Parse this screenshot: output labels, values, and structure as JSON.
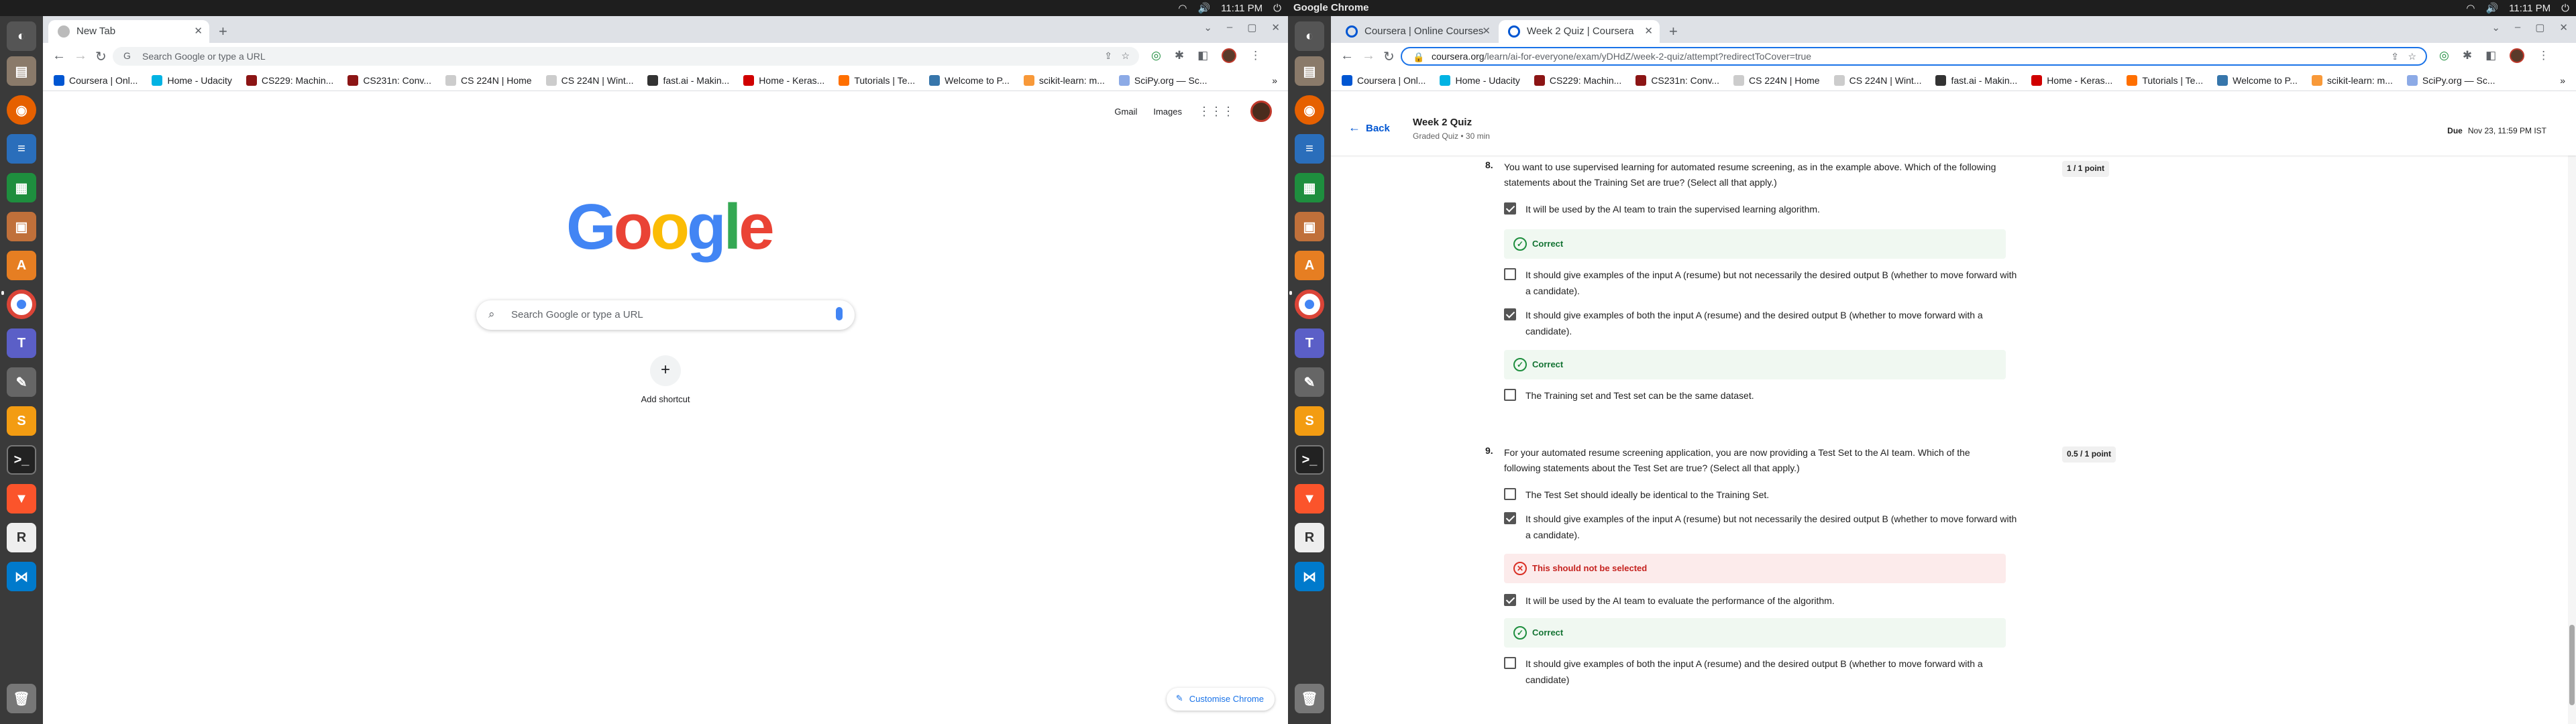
{
  "left": {
    "topbar": {
      "time": "11:11 PM",
      "app": ""
    },
    "tabs": [
      {
        "title": "New Tab"
      }
    ],
    "omnibox": {
      "placeholder": "Search Google or type a URL"
    },
    "bookmarks": [
      "Coursera | Onl...",
      "Home - Udacity",
      "CS229: Machin...",
      "CS231n: Conv...",
      "CS 224N | Home",
      "CS 224N | Wint...",
      "fast.ai - Makin...",
      "Home - Keras...",
      "Tutorials | Te...",
      "Welcome to P...",
      "scikit-learn: m...",
      "SciPy.org — Sc..."
    ],
    "google": {
      "gmail": "Gmail",
      "images": "Images",
      "search_placeholder": "Search Google or type a URL",
      "add_shortcut": "Add shortcut",
      "customise": "Customise Chrome"
    }
  },
  "right": {
    "topbar": {
      "time": "11:11 PM",
      "app": "Google Chrome"
    },
    "tabs": [
      {
        "title": "Coursera | Online Courses"
      },
      {
        "title": "Week 2 Quiz | Coursera"
      }
    ],
    "omnibox": {
      "url_host": "coursera.org",
      "url_path": "/learn/ai-for-everyone/exam/yDHdZ/week-2-quiz/attempt?redirectToCover=true"
    },
    "bookmarks": [
      "Coursera | Onl...",
      "Home - Udacity",
      "CS229: Machin...",
      "CS231n: Conv...",
      "CS 224N | Home",
      "CS 224N | Wint...",
      "fast.ai - Makin...",
      "Home - Keras...",
      "Tutorials | Te...",
      "Welcome to P...",
      "scikit-learn: m...",
      "SciPy.org — Sc..."
    ],
    "quiz": {
      "back": "Back",
      "title": "Week 2 Quiz",
      "subtitle": "Graded Quiz • 30 min",
      "due_label": "Due",
      "due_date": "Nov 23, 11:59 PM IST",
      "questions": [
        {
          "number": "8.",
          "text": "You want to use supervised learning for automated resume screening, as in the example above. Which of the following statements about the Training Set are true? (Select all that apply.)",
          "score": "1 / 1 point",
          "options": [
            {
              "text": "It will be used by the AI team to train the supervised learning algorithm.",
              "checked": true,
              "feedback": "Correct"
            },
            {
              "text": "It should give examples of the input A (resume) but not necessarily the desired output B (whether to move forward with a candidate).",
              "checked": false,
              "feedback": ""
            },
            {
              "text": "It should give examples of both the input A (resume) and the desired output B (whether to move forward with a candidate).",
              "checked": true,
              "feedback": "Correct"
            },
            {
              "text": "The Training set and Test set can be the same dataset.",
              "checked": false,
              "feedback": ""
            }
          ]
        },
        {
          "number": "9.",
          "text": "For your automated resume screening application, you are now providing a Test Set to the AI team. Which of the following statements about the Test Set are true? (Select all that apply.)",
          "score": "0.5 / 1 point",
          "options": [
            {
              "text": "The Test Set should ideally be identical to the Training Set.",
              "checked": false,
              "feedback": ""
            },
            {
              "text": "It should give examples of the input A (resume) but not necessarily the desired output B (whether to move forward with a candidate).",
              "checked": true,
              "feedback": "This should not be selected"
            },
            {
              "text": "It will be used by the AI team to evaluate the performance of the algorithm.",
              "checked": true,
              "feedback": "Correct"
            },
            {
              "text": "It should give examples of both the input A (resume) and the desired output B (whether to move forward with a candidate)",
              "checked": false,
              "feedback": ""
            }
          ]
        }
      ]
    }
  },
  "colors": {
    "accent": "#1a73e8",
    "coursera_blue": "#0056d2",
    "correct": "#137333",
    "incorrect": "#c5221f"
  }
}
